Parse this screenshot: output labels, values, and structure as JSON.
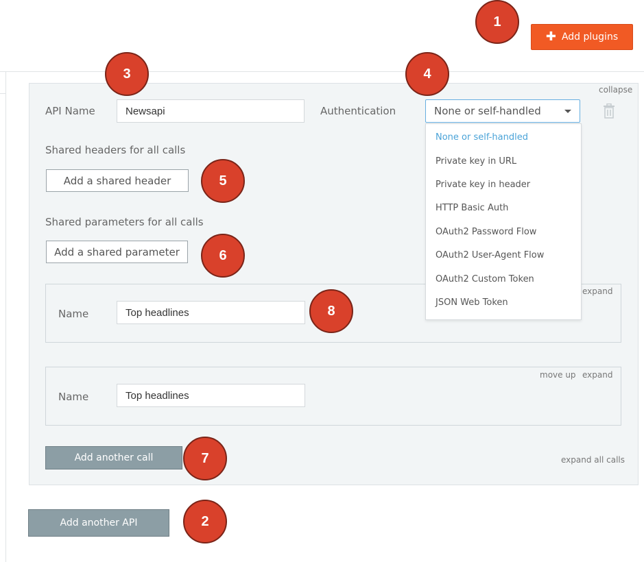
{
  "header": {
    "add_plugins_label": "Add plugins"
  },
  "api": {
    "collapse_label": "collapse",
    "api_name_label": "API Name",
    "api_name_value": "Newsapi",
    "authentication_label": "Authentication",
    "authentication_selected": "None or self-handled",
    "authentication_options": [
      "None or self-handled",
      "Private key in URL",
      "Private key in header",
      "HTTP Basic Auth",
      "OAuth2 Password Flow",
      "OAuth2 User-Agent Flow",
      "OAuth2 Custom Token",
      "JSON Web Token"
    ],
    "shared_headers_label": "Shared headers for all calls",
    "add_shared_header_label": "Add a shared header",
    "shared_params_label": "Shared parameters for all calls",
    "add_shared_param_label": "Add a shared parameter",
    "calls": [
      {
        "name_label": "Name",
        "name_value": "Top headlines",
        "expand_label": "expand"
      },
      {
        "name_label": "Name",
        "name_value": "Top headlines",
        "move_up_label": "move up",
        "expand_label": "expand"
      }
    ],
    "add_another_call_label": "Add another call",
    "expand_all_label": "expand all calls"
  },
  "footer": {
    "add_another_api_label": "Add another API"
  },
  "callouts": [
    "1",
    "2",
    "3",
    "4",
    "5",
    "6",
    "7",
    "8"
  ],
  "colors": {
    "accent": "#f15a24",
    "callout": "#d9412b",
    "selected_option": "#4aa3d8",
    "grey_button": "#8c9ea5"
  }
}
